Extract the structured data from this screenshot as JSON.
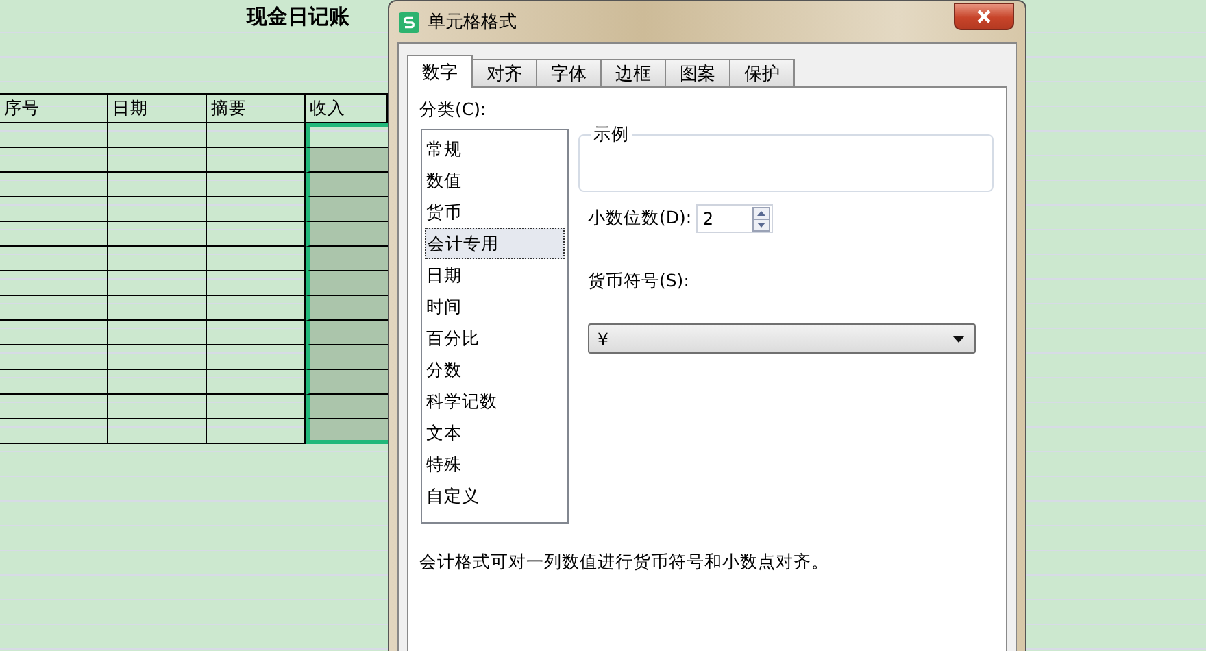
{
  "sheet": {
    "title": "现金日记账",
    "columns": [
      "序号",
      "日期",
      "摘要",
      "收入"
    ]
  },
  "dialog": {
    "title": "单元格格式",
    "tabs": [
      {
        "label": "数字",
        "selected": true
      },
      {
        "label": "对齐",
        "selected": false
      },
      {
        "label": "字体",
        "selected": false
      },
      {
        "label": "边框",
        "selected": false
      },
      {
        "label": "图案",
        "selected": false
      },
      {
        "label": "保护",
        "selected": false
      }
    ],
    "category_label": "分类(C):",
    "categories": [
      {
        "label": "常规",
        "selected": false
      },
      {
        "label": "数值",
        "selected": false
      },
      {
        "label": "货币",
        "selected": false
      },
      {
        "label": "会计专用",
        "selected": true
      },
      {
        "label": "日期",
        "selected": false
      },
      {
        "label": "时间",
        "selected": false
      },
      {
        "label": "百分比",
        "selected": false
      },
      {
        "label": "分数",
        "selected": false
      },
      {
        "label": "科学记数",
        "selected": false
      },
      {
        "label": "文本",
        "selected": false
      },
      {
        "label": "特殊",
        "selected": false
      },
      {
        "label": "自定义",
        "selected": false
      }
    ],
    "sample_label": "示例",
    "decimal_label": "小数位数(D):",
    "decimal_value": "2",
    "currency_label": "货币符号(S):",
    "currency_value": "¥",
    "description": "会计格式可对一列数值进行货币符号和小数点对齐。"
  }
}
